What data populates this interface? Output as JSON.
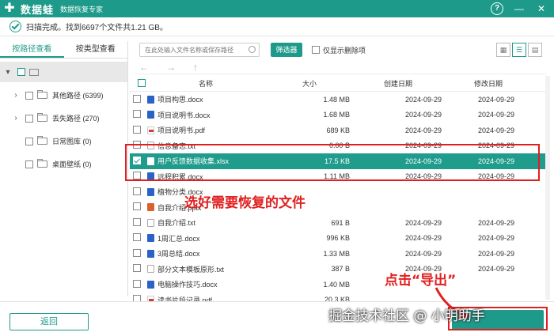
{
  "titlebar": {
    "app_name": "数据蛙",
    "subtitle": "数据恢复专家",
    "help_icon": "?",
    "minimize_icon": "—",
    "close_icon": "✕"
  },
  "status": {
    "text": "扫描完成。找到6697个文件共1.21 GB。"
  },
  "left_panel": {
    "tabs": [
      {
        "label": "按路径查看",
        "active": true
      },
      {
        "label": "按类型查看",
        "active": false
      }
    ],
    "tree": [
      {
        "label": "其他路径 (6399)",
        "expandable": true
      },
      {
        "label": "丢失路径 (270)",
        "expandable": true
      },
      {
        "label": "日常图库 (0)",
        "expandable": false
      },
      {
        "label": "桌面壁纸 (0)",
        "expandable": false
      }
    ]
  },
  "toolbar": {
    "search_placeholder": "在此处输入文件名称或保存路径",
    "filter_label": "筛选器",
    "only_deleted_label": "仅显示删除项"
  },
  "table": {
    "headers": {
      "name": "名称",
      "size": "大小",
      "created": "创建日期",
      "modified": "修改日期"
    },
    "rows": [
      {
        "name": "项目构思.docx",
        "type": "docx",
        "size": "1.48 MB",
        "created": "2024-09-29",
        "modified": "2024-09-29",
        "selected": false
      },
      {
        "name": "项目说明书.docx",
        "type": "docx",
        "size": "1.68 MB",
        "created": "2024-09-29",
        "modified": "2024-09-29",
        "selected": false
      },
      {
        "name": "项目说明书.pdf",
        "type": "pdf",
        "size": "689 KB",
        "created": "2024-09-29",
        "modified": "2024-09-29",
        "selected": false
      },
      {
        "name": "信息备忘.txt",
        "type": "txt",
        "size": "0.00 B",
        "created": "2024-09-29",
        "modified": "2024-09-29",
        "selected": false
      },
      {
        "name": "用户反馈数据收集.xlsx",
        "type": "xlsx",
        "size": "17.5 KB",
        "created": "2024-09-29",
        "modified": "2024-09-29",
        "selected": true
      },
      {
        "name": "远程积累.docx",
        "type": "docx",
        "size": "1.11 MB",
        "created": "2024-09-29",
        "modified": "2024-09-29",
        "selected": false
      },
      {
        "name": "植物分类.docx",
        "type": "docx",
        "size": "",
        "created": "",
        "modified": "",
        "selected": false
      },
      {
        "name": "自我介绍.pptx",
        "type": "pptx",
        "size": "",
        "created": "",
        "modified": "",
        "selected": false
      },
      {
        "name": "自我介绍.txt",
        "type": "txt",
        "size": "691 B",
        "created": "2024-09-29",
        "modified": "2024-09-29",
        "selected": false
      },
      {
        "name": "1周汇总.docx",
        "type": "docx",
        "size": "996 KB",
        "created": "2024-09-29",
        "modified": "2024-09-29",
        "selected": false
      },
      {
        "name": "3周总结.docx",
        "type": "docx",
        "size": "1.33 MB",
        "created": "2024-09-29",
        "modified": "2024-09-29",
        "selected": false
      },
      {
        "name": "部分文本模板原形.txt",
        "type": "txt",
        "size": "387 B",
        "created": "2024-09-29",
        "modified": "2024-09-29",
        "selected": false
      },
      {
        "name": "电脑操作技巧.docx",
        "type": "docx",
        "size": "1.40 MB",
        "created": "",
        "modified": "",
        "selected": false
      },
      {
        "name": "读书片段记录.pdf",
        "type": "pdf",
        "size": "20.3 KB",
        "created": "",
        "modified": "",
        "selected": false
      }
    ]
  },
  "bottom": {
    "back_label": "返回"
  },
  "annotations": {
    "select_text": "选好需要恢复的文件",
    "export_text": "点击“导出”",
    "watermark": "掘金技术社区 @ 小明助手"
  }
}
